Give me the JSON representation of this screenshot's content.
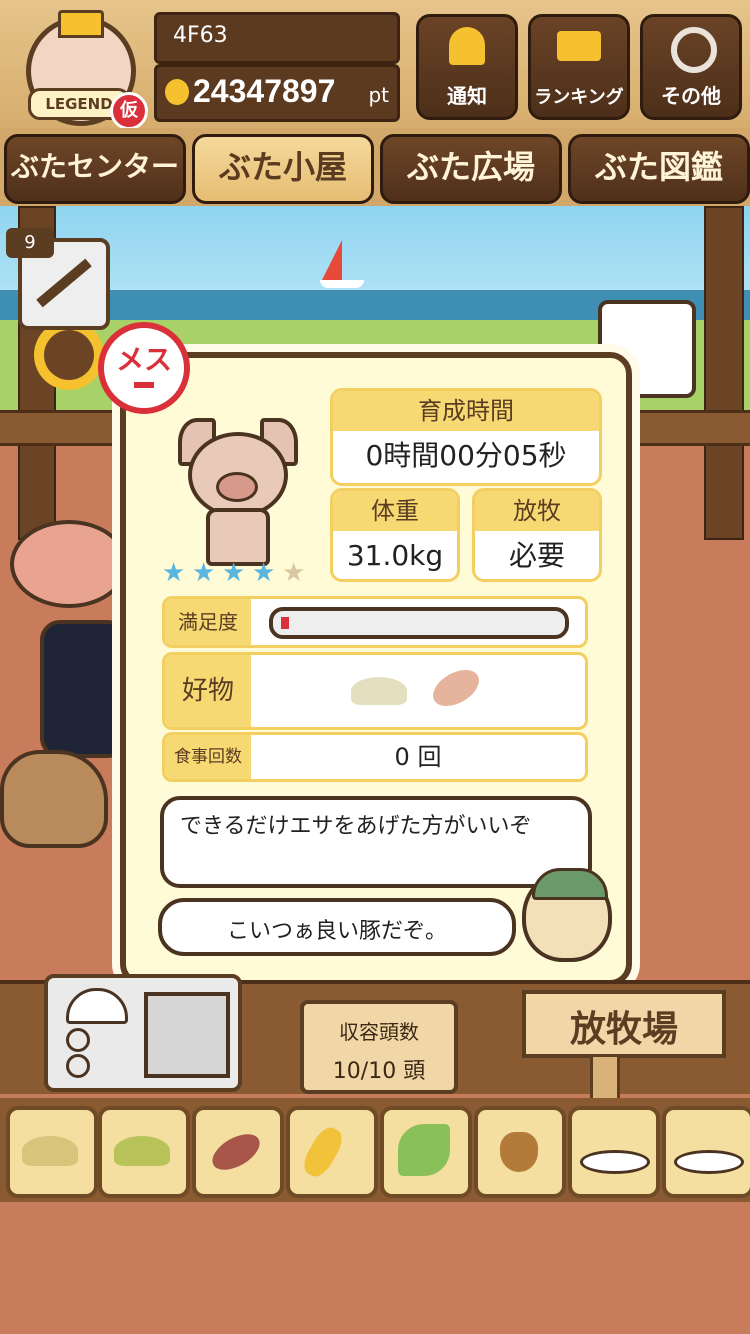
{
  "header": {
    "badge_text": "LEGEND",
    "badge_tag": "仮",
    "player_id": "4F63",
    "points": "24347897",
    "points_unit": "pt",
    "buttons": {
      "notify": "通知",
      "ranking": "ランキング",
      "other": "その他"
    }
  },
  "tabs": [
    {
      "label": "ぶたセンター"
    },
    {
      "label": "ぶた小屋"
    },
    {
      "label": "ぶた広場"
    },
    {
      "label": "ぶた図鑑"
    }
  ],
  "item_slot": {
    "count": "9",
    "icon": "syringe-icon"
  },
  "pig": {
    "sex_label": "メス",
    "rating": 4,
    "rating_max": 5,
    "growth_time_label": "育成時間",
    "growth_time_value": "0時間00分05秒",
    "weight_label": "体重",
    "weight_value": "31.0kg",
    "grazing_label": "放牧",
    "grazing_value": "必要",
    "satisfaction_label": "満足度",
    "satisfaction_level": 0.03,
    "favorite_label": "好物",
    "favorite_foods": [
      "grain-icon",
      "sweet-potato-icon"
    ],
    "meals_label": "食事回数",
    "meals_value": "0 回"
  },
  "dialogue": {
    "line1": "できるだけエサをあげた方がいいぞ",
    "line2": "こいつぁ良い豚だぞ。"
  },
  "capacity": {
    "label": "収容頭数",
    "value": "10/10 頭"
  },
  "pasture_sign": "放牧場",
  "food_bar": [
    "grain-icon",
    "mixed-grain-icon",
    "sweet-potato-icon",
    "corn-icon",
    "green-beans-icon",
    "acorn-icon",
    "bean-plate-icon",
    "truffle-plate-icon"
  ],
  "colors": {
    "accent": "#f7d974",
    "wood": "#5b3d22",
    "panel": "#fffbd6",
    "female": "#d9303a"
  }
}
